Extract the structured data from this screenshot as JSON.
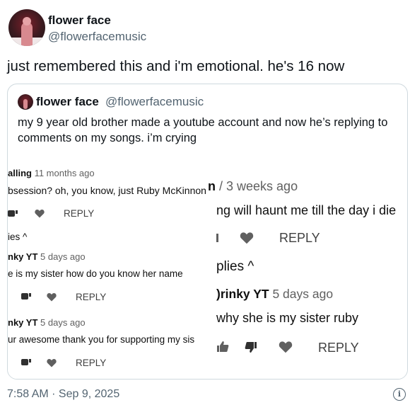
{
  "author": {
    "name": "flower face",
    "handle": "@flowerfacemusic"
  },
  "tweet": {
    "text": "just remembered this and i'm emotional. he's 16 now",
    "timestamp": "7:58 AM · Sep 9, 2025"
  },
  "quote": {
    "name": "flower face",
    "handle": "@flowerfacemusic",
    "text": "my 9 year old brother made a youtube account and now he’s replying to comments on my songs. i’m crying"
  },
  "screenshot_left": {
    "c1_user": "alling",
    "c1_age": "11 months ago",
    "c1_text": "bsession? oh, you know, just Ruby McKinnon",
    "c1_reply": "REPLY",
    "replies_toggle": "ies ^",
    "r1_user": "nky YT",
    "r1_age": "5 days ago",
    "r1_text": "e is my sister how do you know her name",
    "r1_reply": "REPLY",
    "r2_user": "nky YT",
    "r2_age": "5 days ago",
    "r2_text": "ur awesome thank you for supporting my sis",
    "r2_reply": "REPLY"
  },
  "screenshot_right": {
    "c1_header_tail": "n",
    "c1_age": "/ 3 weeks ago",
    "c1_text": "ng will haunt me till the day i die",
    "c1_reply": "REPLY",
    "replies_toggle": "plies ^",
    "r1_user": ")rinky YT",
    "r1_age": "5 days ago",
    "r1_text": "why she is my sister ruby",
    "r1_reply": "REPLY"
  }
}
